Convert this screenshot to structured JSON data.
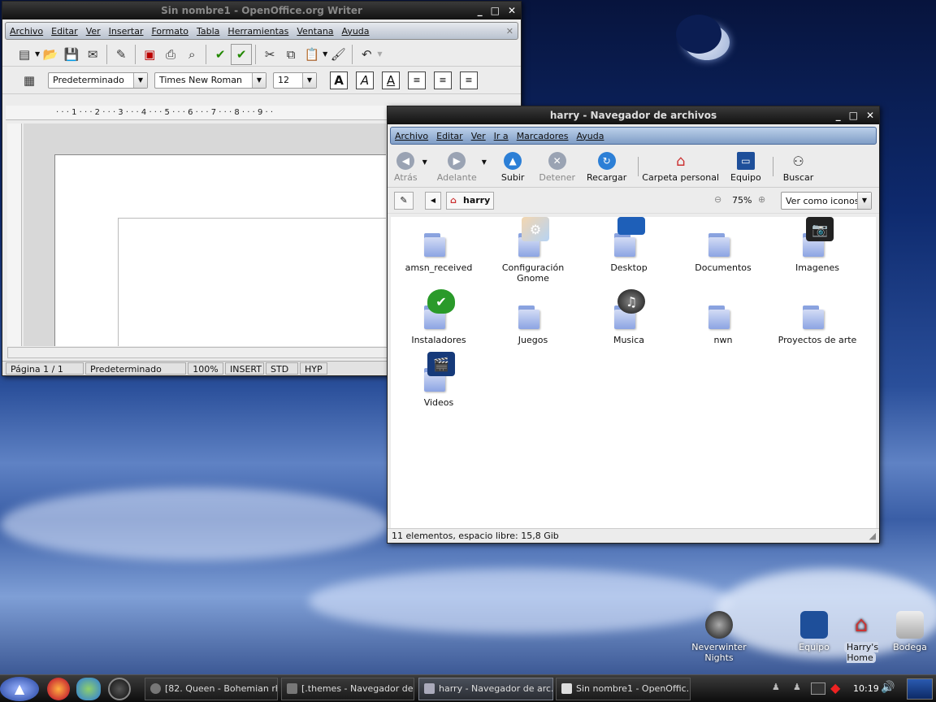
{
  "writer": {
    "title": "Sin nombre1 - OpenOffice.org Writer",
    "menu": [
      "Archivo",
      "Editar",
      "Ver",
      "Insertar",
      "Formato",
      "Tabla",
      "Herramientas",
      "Ventana",
      "Ayuda"
    ],
    "style": "Predeterminado",
    "font": "Times New Roman",
    "size": "12",
    "ruler": "· · · 1 · · · 2 · · · 3 · · · 4 · · · 5 · · · 6 · · · 7 · · · 8 · · · 9 · ·",
    "status": [
      "Página  1 / 1",
      "Predeterminado",
      "100%",
      "INSERT",
      "STD",
      "HYP"
    ]
  },
  "nautilus": {
    "title": "harry - Navegador de archivos",
    "menu": [
      "Archivo",
      "Editar",
      "Ver",
      "Ir a",
      "Marcadores",
      "Ayuda"
    ],
    "toolbar": [
      "Atrás",
      "Adelante",
      "Subir",
      "Detener",
      "Recargar",
      "Carpeta personal",
      "Equipo",
      "Buscar"
    ],
    "location": "harry",
    "zoom": "75%",
    "view_mode": "Ver como iconos",
    "items": [
      "amsn_received",
      "Configuración Gnome",
      "Desktop",
      "Documentos",
      "Imagenes",
      "Instaladores",
      "Juegos",
      "Musica",
      "nwn",
      "Proyectos de arte",
      "Videos"
    ],
    "status": "11 elementos, espacio libre: 15,8 Gib"
  },
  "desktop_icons": [
    "Neverwinter Nights",
    "Equipo",
    "Harry's Home",
    "Bodega"
  ],
  "taskbar": {
    "tasks": [
      "[82. Queen - Bohemian rh...",
      "[.themes - Navegador de ...",
      "harry - Navegador de arc...",
      "Sin nombre1 - OpenOffic..."
    ],
    "clock": "10:19"
  }
}
